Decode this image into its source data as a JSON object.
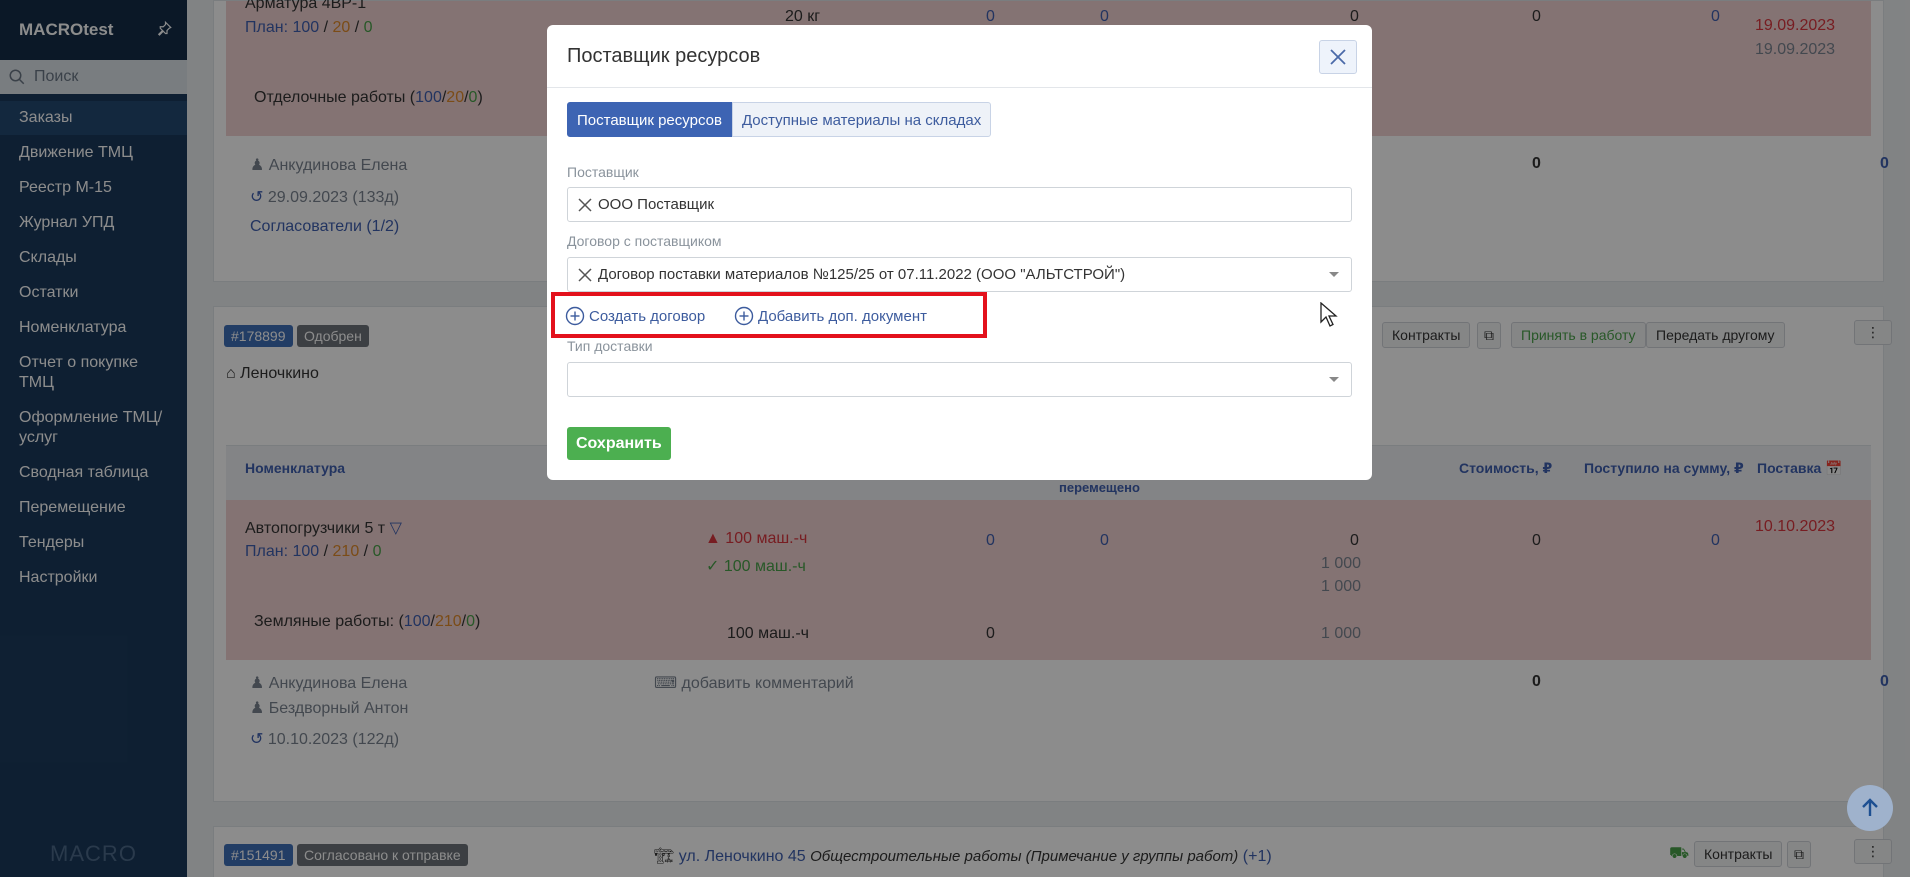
{
  "sidebar": {
    "app_title": "MACROtest",
    "search_placeholder": "Поиск",
    "items": [
      {
        "label": "Заказы"
      },
      {
        "label": "Движение ТМЦ"
      },
      {
        "label": "Реестр М-15"
      },
      {
        "label": "Журнал УПД"
      },
      {
        "label": "Склады"
      },
      {
        "label": "Остатки"
      },
      {
        "label": "Номенклатура"
      },
      {
        "label": "Отчет о покупке ТМЦ"
      },
      {
        "label": "Оформление ТМЦ/ услуг"
      },
      {
        "label": "Сводная таблица"
      },
      {
        "label": "Перемещение"
      },
      {
        "label": "Тендеры"
      },
      {
        "label": "Настройки"
      }
    ],
    "footer_logo": "MACRO"
  },
  "bg": {
    "order1": {
      "item_name": "Арматура 4ВР-1",
      "plan_label": "План:",
      "plan_a": "100",
      "plan_b": "20",
      "plan_c": "0",
      "qty": "20 кг",
      "v1": "0",
      "v2": "0",
      "v3": "0",
      "v4": "0",
      "v5": "0",
      "date1": "19.09.2023",
      "date2": "19.09.2023",
      "work_name": "Отделочные работы (",
      "work_a": "100",
      "work_b": "20",
      "work_c": "0",
      "person": "Анкудинова Елена",
      "deadline": "29.09.2023 (133д)",
      "approvers": "Согласователи (1/2)",
      "total1": "0",
      "total2": "0"
    },
    "order2": {
      "number": "#178899",
      "status": "Одобрен",
      "location": "Леночкино",
      "btn_contracts": "Контракты",
      "btn_accept": "Принять в работу",
      "btn_transfer": "Передать другому",
      "col_nomenclature": "Номенклатура",
      "col_moved": "перемещено",
      "col_cost": "Стоимость, ₽",
      "col_received": "Поступило на сумму, ₽",
      "col_delivery": "Поставка",
      "item_name": "Автопогрузчики 5 т",
      "plan_label": "План:",
      "plan_a": "100",
      "plan_b": "210",
      "plan_c": "0",
      "qty_warn": "100 маш.-ч",
      "qty_ok": "100 маш.-ч",
      "qty_total": "100 маш.-ч",
      "v1": "0",
      "v2": "0",
      "v3": "0",
      "v4": "0",
      "v5": "0",
      "v6": "0",
      "n1": "1 000",
      "n2": "1 000",
      "n3": "1 000",
      "delivery_date": "10.10.2023",
      "work_name": "Земляные работы: (",
      "work_a": "100",
      "work_b": "210",
      "work_c": "0",
      "person1": "Анкудинова Елена",
      "person2": "Бездворный Антон",
      "deadline": "10.10.2023 (122д)",
      "comment": "добавить комментарий",
      "total1": "0",
      "total2": "0"
    },
    "order3": {
      "number": "#151491",
      "status": "Согласовано к отправке",
      "address": "ул. Леночкино 45",
      "note": "Общестроительные работы (Примечание у группы работ)",
      "note_more": "(+1)",
      "btn_contracts": "Контракты"
    }
  },
  "modal": {
    "title": "Поставщик ресурсов",
    "tabs": [
      {
        "label": "Поставщик ресурсов"
      },
      {
        "label": "Доступные материалы на складах"
      }
    ],
    "supplier_label": "Поставщик",
    "supplier_value": "ООО Поставщик",
    "contract_label": "Договор с поставщиком",
    "contract_value": "Договор поставки материалов №125/25 от 07.11.2022 (ООО \"АЛЬТСТРОЙ\")",
    "create_contract": "Создать договор",
    "add_document": "Добавить доп. документ",
    "delivery_label": "Тип доставки",
    "delivery_value": "",
    "save_label": "Сохранить"
  },
  "colors": {
    "sidebar_bg": "#1b3a5c",
    "primary": "#3d64b3",
    "save_green": "#4caf50",
    "highlight_red": "#e3111c"
  }
}
